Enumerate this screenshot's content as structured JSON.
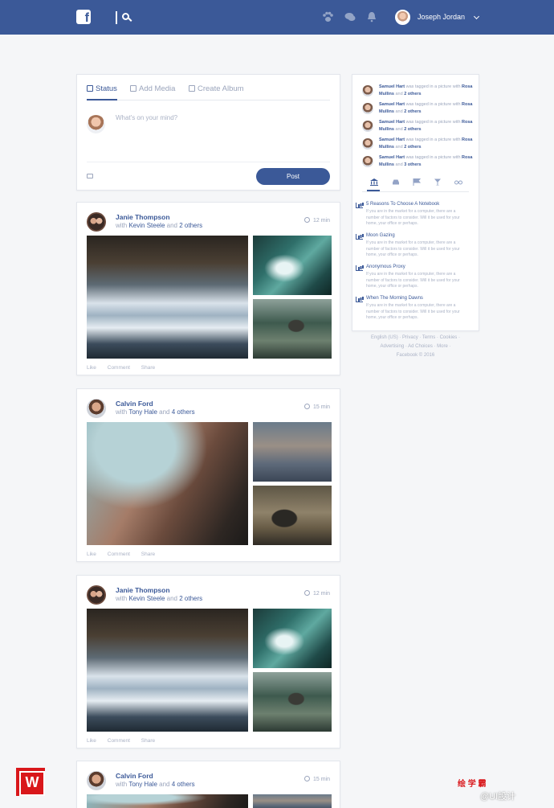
{
  "header": {
    "username": "Joseph Jordan",
    "brand_color": "#3b5998",
    "icons": [
      "facebook-logo-icon",
      "search-icon",
      "paw-icon",
      "chat-icon",
      "bell-icon",
      "chevron-down-icon"
    ]
  },
  "composer": {
    "tabs": [
      {
        "label": "Status",
        "icon": "edit-icon",
        "active": true
      },
      {
        "label": "Add Media",
        "icon": "image-icon",
        "active": false
      },
      {
        "label": "Create Album",
        "icon": "album-icon",
        "active": false
      }
    ],
    "placeholder": "What's on your mind?",
    "post_label": "Post"
  },
  "posts": [
    {
      "name": "Janie Thompson",
      "with_prefix": "with",
      "with_name": "Kevin Steele",
      "and": "and",
      "others": "2 others",
      "time": "12 min",
      "actions": {
        "like": "Like",
        "comment": "Comment",
        "share": "Share"
      }
    },
    {
      "name": "Calvin Ford",
      "with_prefix": "with",
      "with_name": "Tony Hale",
      "and": "and",
      "others": "4 others",
      "time": "15 min",
      "actions": {
        "like": "Like",
        "comment": "Comment",
        "share": "Share"
      }
    },
    {
      "name": "Janie Thompson",
      "with_prefix": "with",
      "with_name": "Kevin Steele",
      "and": "and",
      "others": "2 others",
      "time": "12 min",
      "actions": {
        "like": "Like",
        "comment": "Comment",
        "share": "Share"
      }
    },
    {
      "name": "Calvin Ford",
      "with_prefix": "with",
      "with_name": "Tony Hale",
      "and": "and",
      "others": "4 others",
      "time": "15 min"
    }
  ],
  "sidebar": {
    "activity": [
      {
        "name": "Samuel Hart",
        "text": "was tagged in a picture with",
        "friend": "Rosa Mullins",
        "and": "and",
        "others": "2 others"
      },
      {
        "name": "Samuel Hart",
        "text": "was tagged in a picture with",
        "friend": "Rosa Mullins",
        "and": "and",
        "others": "2 others"
      },
      {
        "name": "Samuel Hart",
        "text": "was tagged in a picture with",
        "friend": "Rosa Mullins",
        "and": "and",
        "others": "2 others"
      },
      {
        "name": "Samuel Hart",
        "text": "was tagged in a picture with",
        "friend": "Rosa Mullins",
        "and": "and",
        "others": "2 others"
      },
      {
        "name": "Samuel Hart",
        "text": "was tagged in a picture with",
        "friend": "Rosa Mullins",
        "and": "and",
        "others": "3 others"
      }
    ],
    "categories": [
      "bank-icon",
      "car-icon",
      "flag-icon",
      "drink-icon",
      "glasses-icon"
    ],
    "articles": [
      {
        "title": "5 Reasons To Choose A Notebook",
        "desc": "If you are in the market for a computer, there are a number of factors to consider. Will it be used for your home, your office or perhaps."
      },
      {
        "title": "Moon Gazing",
        "desc": "If you are in the market for a computer, there are a number of factors to consider. Will it be used for your home, your office or perhaps."
      },
      {
        "title": "Anonymous Proxy",
        "desc": "If you are in the market for a computer, there are a number of factors to consider. Will it be used for your home, your office or perhaps."
      },
      {
        "title": "When The Morning Dawns",
        "desc": "If you are in the market for a computer, there are a number of factors to consider. Will it be used for your home, your office or perhaps."
      }
    ],
    "footer": {
      "line1": "English (US) · Privacy · Terms · Cookies ·",
      "line2": "Advertising · Ad Choices · More ·",
      "line3": "Facebook © 2016"
    }
  },
  "watermark": {
    "text_cn": "绘 学 霸",
    "text_ui": "@UI設计"
  }
}
